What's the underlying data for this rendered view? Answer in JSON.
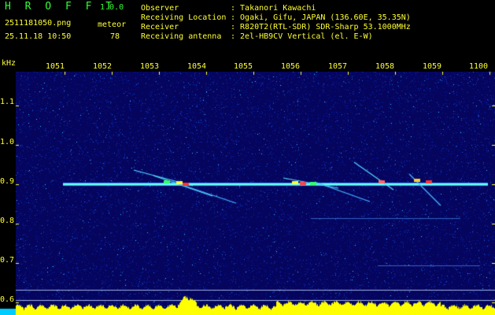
{
  "header": {
    "app_name": "H R O F F T",
    "version": "1.0.0",
    "filename": "2511181050.png",
    "datetime": "25.11.18 10:50",
    "count_label": "meteor",
    "count_value": "78",
    "fields": [
      {
        "label": "Observer",
        "value": ": Takanori Kawachi"
      },
      {
        "label": "Receiving Location",
        "value": ": Ogaki, Gifu, JAPAN (136.60E, 35.35N)"
      },
      {
        "label": "Receiver",
        "value": ": R820T2(RTL-SDR) SDR-Sharp 53.1000MHz"
      },
      {
        "label": "Receiving antenna",
        "value": ": 2el-HB9CV Vertical (el. E-W)"
      }
    ]
  },
  "axes": {
    "unit_label": "kHz",
    "x_ticks": [
      "1051",
      "1052",
      "1053",
      "1054",
      "1055",
      "1056",
      "1057",
      "1058",
      "1059",
      "1100"
    ],
    "y_ticks": [
      "1.1",
      "1.0",
      "0.9",
      "0.8",
      "0.7",
      "0.6"
    ]
  },
  "colors": {
    "header_text": "#ffff33",
    "title_text": "#33ff33",
    "background": "#05055e",
    "signal_line": "#66ffff",
    "level_bars": "#ffff00"
  }
}
